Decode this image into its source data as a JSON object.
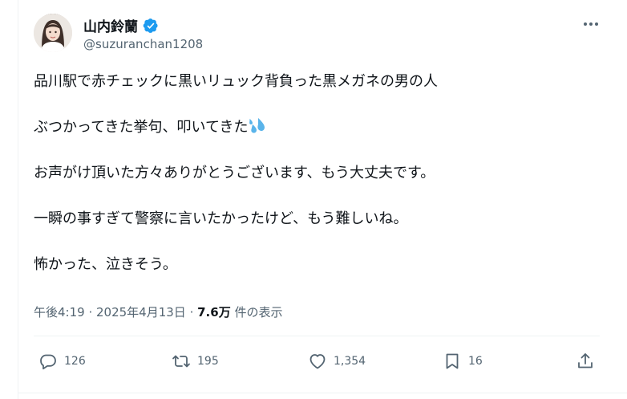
{
  "user": {
    "display_name": "山内鈴蘭",
    "handle": "@suzuranchan1208"
  },
  "tweet": {
    "lines": [
      "品川駅で赤チェックに黒いリュック背負った黒メガネの男の人",
      "ぶつかってきた挙句、叩いてきた",
      "お声がけ頂いた方々ありがとうございます、もう大丈夫です。",
      "一瞬の事すぎて警察に言いたかったけど、もう難しいね。",
      "怖かった、泣きそう。"
    ],
    "emoji": "sweat-droplets-icon"
  },
  "meta": {
    "time": "午後4:19",
    "sep1": " · ",
    "date": "2025年4月13日",
    "sep2": " · ",
    "views": "7.6万",
    "views_label": " 件の表示"
  },
  "actions": {
    "reply_count": "126",
    "retweet_count": "195",
    "like_count": "1,354",
    "bookmark_count": "16"
  },
  "colors": {
    "verified": "#1d9bf0",
    "secondary_text": "#536471",
    "primary_text": "#0f1419",
    "emoji": "#5ab4ea"
  }
}
